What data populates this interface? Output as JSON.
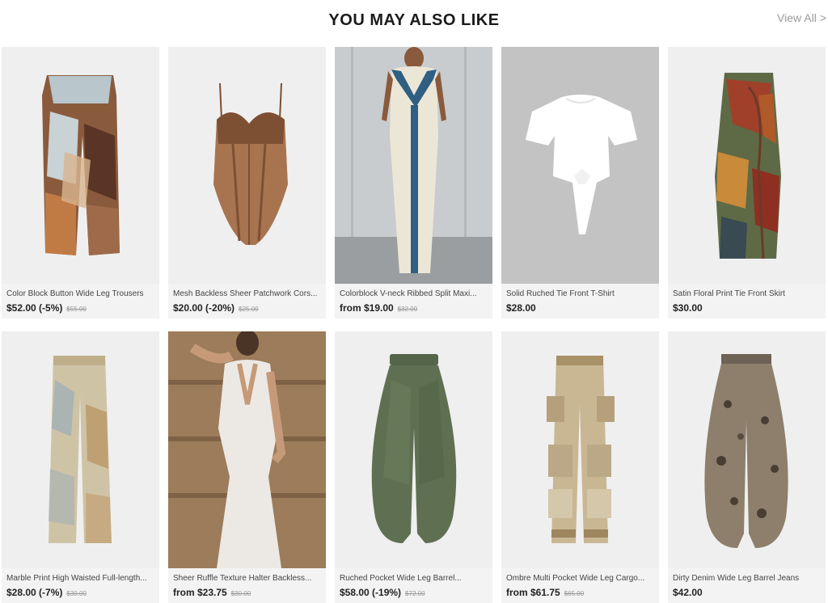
{
  "header": {
    "title": "YOU MAY ALSO LIKE",
    "view_all": "View All",
    "view_all_icon": "chevron-right-icon"
  },
  "products": [
    {
      "name": "Color Block Button Wide Leg Trousers",
      "price": "$52.00 (-5%)",
      "old_price": "$55.00"
    },
    {
      "name": "Mesh Backless Sheer Patchwork Cors...",
      "price": "$20.00 (-20%)",
      "old_price": "$25.00"
    },
    {
      "name": "Colorblock V-neck Ribbed Split Maxi...",
      "price": "from $19.00",
      "old_price": "$32.00"
    },
    {
      "name": "Solid Ruched Tie Front T-Shirt",
      "price": "$28.00",
      "old_price": ""
    },
    {
      "name": "Satin Floral Print Tie Front Skirt",
      "price": "$30.00",
      "old_price": ""
    },
    {
      "name": "Marble Print High Waisted Full-length...",
      "price": "$28.00 (-7%)",
      "old_price": "$30.00"
    },
    {
      "name": "Sheer Ruffle Texture Halter Backless...",
      "price": "from $23.75",
      "old_price": "$30.00"
    },
    {
      "name": "Ruched Pocket Wide Leg Barrel...",
      "price": "$58.00 (-19%)",
      "old_price": "$72.00"
    },
    {
      "name": "Ombre Multi Pocket Wide Leg Cargo...",
      "price": "from $61.75",
      "old_price": "$65.00"
    },
    {
      "name": "Dirty Denim Wide Leg Barrel Jeans",
      "price": "$42.00",
      "old_price": ""
    }
  ]
}
